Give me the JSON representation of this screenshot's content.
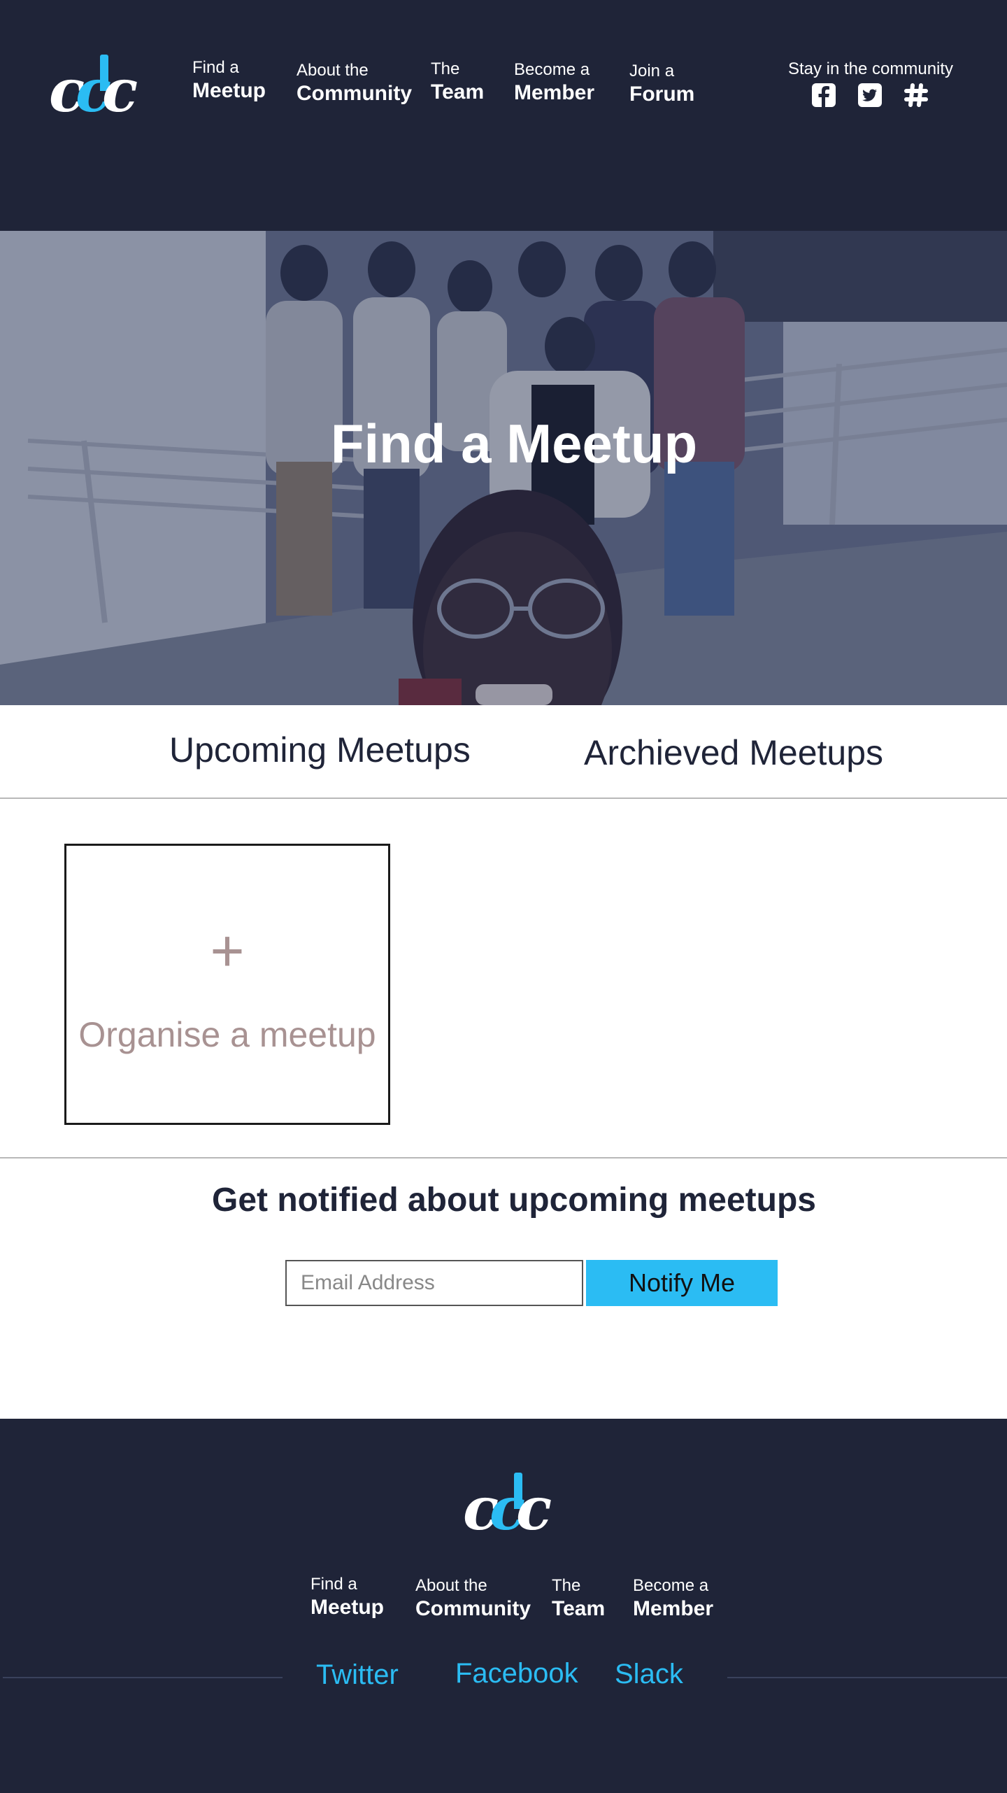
{
  "brand": {
    "logo_letters": [
      "c",
      "d",
      "c"
    ],
    "logo_text": "cdc",
    "colors": {
      "navy": "#1f2438",
      "accent": "#2bbcf3",
      "muted": "#a89292"
    }
  },
  "nav": {
    "items": [
      {
        "small": "Find a",
        "big": "Meetup"
      },
      {
        "small": "About the",
        "big": "Community"
      },
      {
        "small": "The",
        "big": "Team"
      },
      {
        "small": "Become a",
        "big": "Member"
      },
      {
        "small": "Join a",
        "big": "Forum"
      }
    ]
  },
  "social": {
    "title": "Stay in the community",
    "icons": [
      "facebook-icon",
      "twitter-icon",
      "slack-icon"
    ]
  },
  "hero": {
    "title": "Find a Meetup"
  },
  "tabs": {
    "upcoming": "Upcoming Meetups",
    "archived": "Archieved Meetups"
  },
  "organise": {
    "plus": "+",
    "label": "Organise a meetup"
  },
  "notify": {
    "title": "Get notified about upcoming meetups",
    "email_placeholder": "Email Address",
    "email_value": "",
    "button_label": "Notify Me"
  },
  "footer": {
    "nav": [
      {
        "small": "Find a",
        "big": "Meetup"
      },
      {
        "small": "About the",
        "big": "Community"
      },
      {
        "small": "The",
        "big": "Team"
      },
      {
        "small": "Become a",
        "big": "Member"
      }
    ],
    "links": {
      "twitter": "Twitter",
      "facebook": "Facebook",
      "slack": "Slack"
    }
  }
}
